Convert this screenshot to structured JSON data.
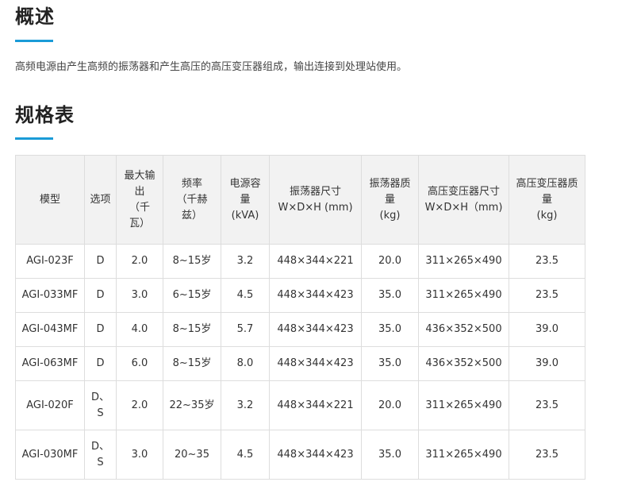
{
  "overview": {
    "title": "概述",
    "text": "高频电源由产生高频的振荡器和产生高压的高压变压器组成，输出连接到处理站使用。"
  },
  "spec": {
    "title": "规格表",
    "headers": [
      "模型",
      "选项",
      "最大输\n出\n（千\n瓦）",
      "频率\n（千赫\n兹）",
      "电源容\n量\n(kVA)",
      "振荡器尺寸\nW×D×H (mm)",
      "振荡器质\n量\n(kg)",
      "高压变压器尺寸\nW×D×H（mm)",
      "高压变压器质\n量\n(kg)"
    ],
    "rows": [
      [
        "AGI-023F",
        "D",
        "2.0",
        "8~15岁",
        "3.2",
        "448×344×221",
        "20.0",
        "311×265×490",
        "23.5"
      ],
      [
        "AGI-033MF",
        "D",
        "3.0",
        "6~15岁",
        "4.5",
        "448×344×423",
        "35.0",
        "311×265×490",
        "23.5"
      ],
      [
        "AGI-043MF",
        "D",
        "4.0",
        "8~15岁",
        "5.7",
        "448×344×423",
        "35.0",
        "436×352×500",
        "39.0"
      ],
      [
        "AGI-063MF",
        "D",
        "6.0",
        "8~15岁",
        "8.0",
        "448×344×423",
        "35.0",
        "436×352×500",
        "39.0"
      ],
      [
        "AGI-020F",
        "D、\nS",
        "2.0",
        "22~35岁",
        "3.2",
        "448×344×221",
        "20.0",
        "311×265×490",
        "23.5"
      ],
      [
        "AGI-030MF",
        "D、\nS",
        "3.0",
        "20~35",
        "4.5",
        "448×344×423",
        "35.0",
        "311×265×490",
        "23.5"
      ]
    ]
  }
}
